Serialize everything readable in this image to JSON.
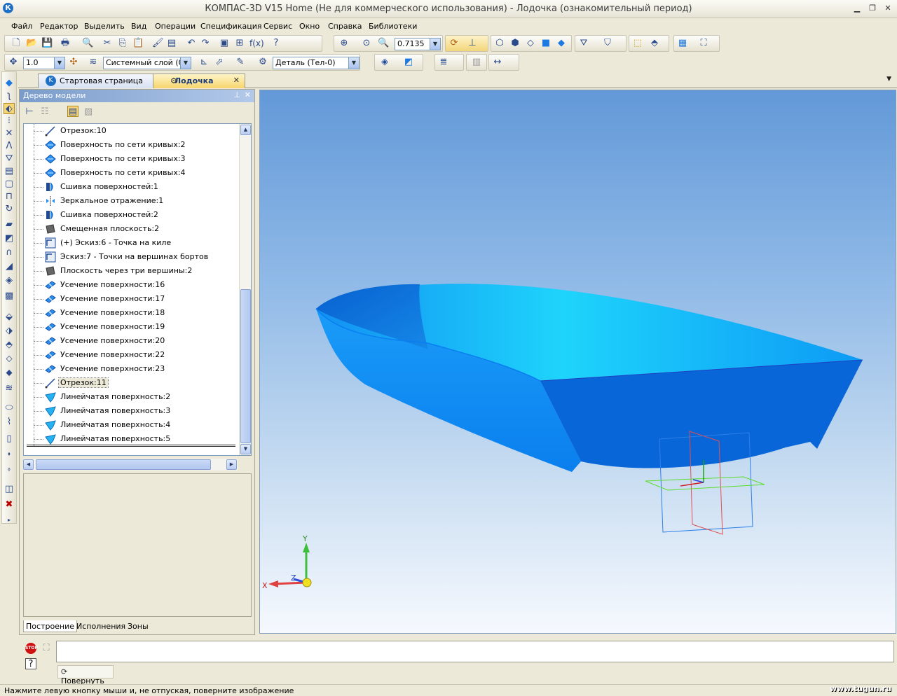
{
  "window": {
    "title": "КОМПАС-3D V15 Home (Не для коммерческого использования) - Лодочка (ознакомительный период)"
  },
  "menu": [
    "Файл",
    "Редактор",
    "Выделить",
    "Вид",
    "Операции",
    "Спецификация",
    "Сервис",
    "Окно",
    "Справка",
    "Библиотеки"
  ],
  "toolbar": {
    "zoom_value": "0.7135",
    "step_value": "1.0",
    "layer_value": "Системный слой (0)",
    "body_value": "Деталь (Тел-0)"
  },
  "tabs": [
    {
      "label": "Стартовая страница"
    },
    {
      "label": "Лодочка"
    }
  ],
  "panel": {
    "title": "Дерево модели"
  },
  "tree": [
    {
      "label": "Отрезок:10",
      "icon": "segment-icon"
    },
    {
      "label": "Поверхность по сети кривых:2",
      "icon": "surface-icon"
    },
    {
      "label": "Поверхность по сети кривых:3",
      "icon": "surface-icon"
    },
    {
      "label": "Поверхность по сети кривых:4",
      "icon": "surface-icon"
    },
    {
      "label": "Сшивка поверхностей:1",
      "icon": "stitch-icon"
    },
    {
      "label": "Зеркальное отражение:1",
      "icon": "mirror-icon"
    },
    {
      "label": "Сшивка поверхностей:2",
      "icon": "stitch-icon"
    },
    {
      "label": "Смещенная плоскость:2",
      "icon": "plane-icon"
    },
    {
      "label": "(+) Эскиз:6 - Точка на киле",
      "icon": "sketch-icon"
    },
    {
      "label": "Эскиз:7 - Точки на вершинах бортов",
      "icon": "sketch-icon"
    },
    {
      "label": "Плоскость через три вершины:2",
      "icon": "plane-icon"
    },
    {
      "label": "Усечение поверхности:16",
      "icon": "trim-icon"
    },
    {
      "label": "Усечение поверхности:17",
      "icon": "trim-icon"
    },
    {
      "label": "Усечение поверхности:18",
      "icon": "trim-icon"
    },
    {
      "label": "Усечение поверхности:19",
      "icon": "trim-icon"
    },
    {
      "label": "Усечение поверхности:20",
      "icon": "trim-icon"
    },
    {
      "label": "Усечение поверхности:22",
      "icon": "trim-icon"
    },
    {
      "label": "Усечение поверхности:23",
      "icon": "trim-icon"
    },
    {
      "label": "Отрезок:11",
      "icon": "segment-icon",
      "selected": true
    },
    {
      "label": "Линейчатая поверхность:2",
      "icon": "ruled-icon"
    },
    {
      "label": "Линейчатая поверхность:3",
      "icon": "ruled-icon"
    },
    {
      "label": "Линейчатая поверхность:4",
      "icon": "ruled-icon"
    },
    {
      "label": "Линейчатая поверхность:5",
      "icon": "ruled-icon"
    }
  ],
  "panel_tabs": [
    "Построение",
    "Исполнения",
    "Зоны"
  ],
  "axes": {
    "x": "X",
    "y": "Y",
    "z": "Z"
  },
  "command": {
    "rotate_label": "Повернуть"
  },
  "status": {
    "text": "Нажмите левую кнопку мыши и, не отпуская, поверните изображение"
  },
  "watermark": "www.tugun.ru",
  "colors": {
    "hull": "#0a7ef0",
    "hull_dark": "#0560cc",
    "inner": "#22b8f0",
    "accent": "#316ac5"
  }
}
